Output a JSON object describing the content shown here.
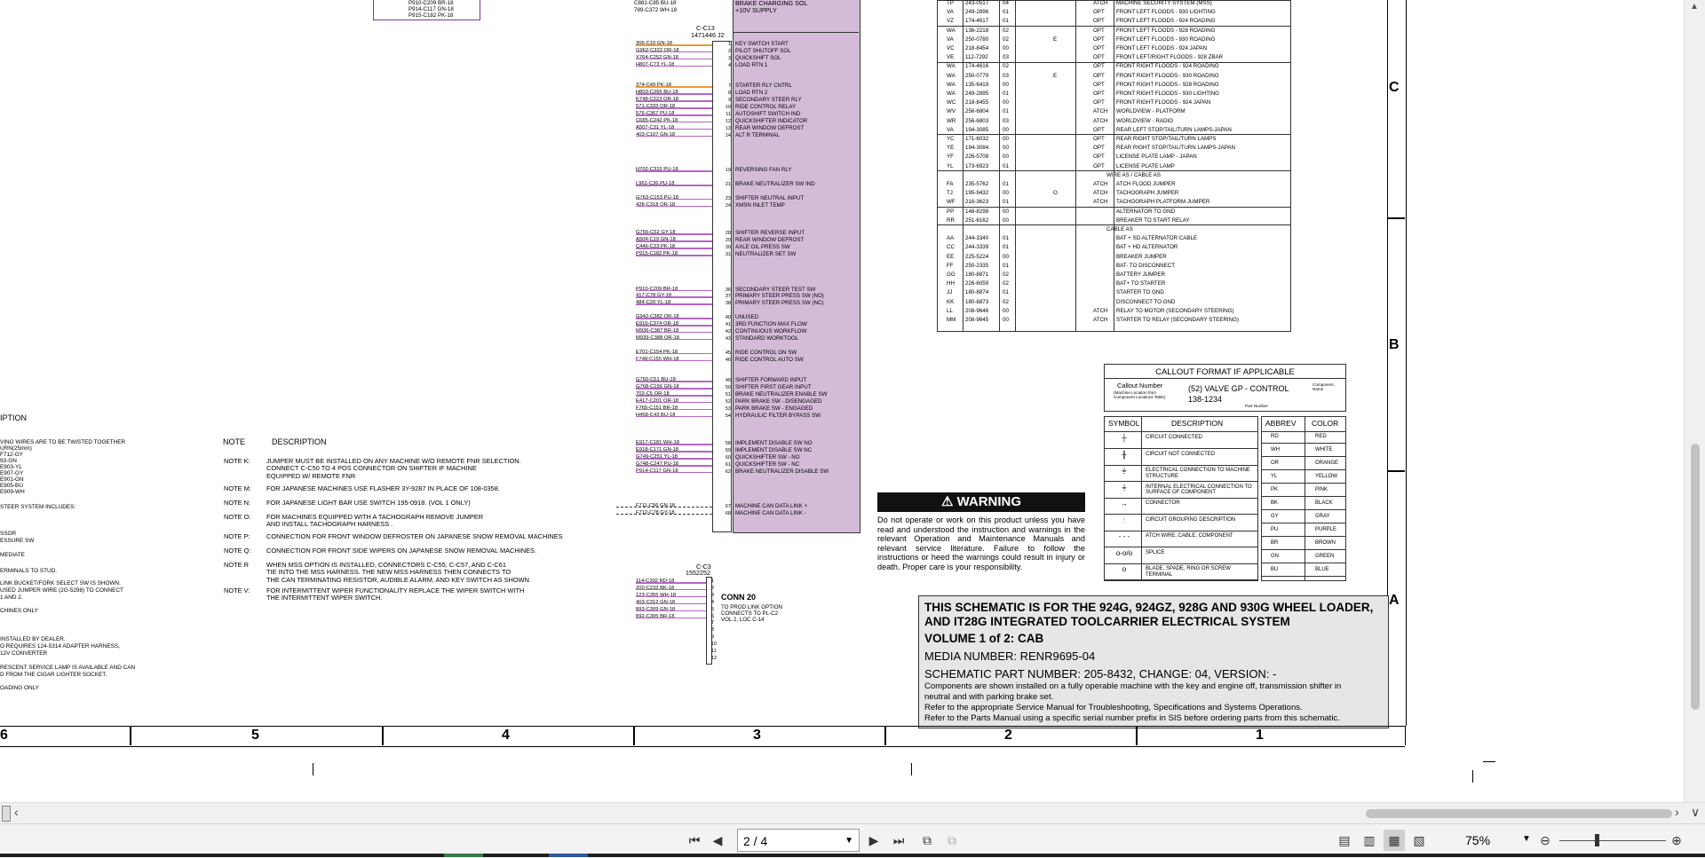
{
  "viewer": {
    "page_indicator": "2 / 4",
    "zoom": "75%"
  },
  "pins_text": {
    "top_left_wires": [
      "P910-C209 BR-18",
      "P914-C117 GN-18",
      "P915-C182 PK-18"
    ],
    "top_circuits": [
      "C881-C85 BU-18",
      "789-C372 WH-18"
    ],
    "top_descs": [
      "BRAKE CHARGING SOL",
      "+10V SUPPLY"
    ],
    "conn_c13_name": "C-C13",
    "conn_c13_part": "1471446 J2"
  },
  "connector_rows": [
    {
      "pin": "1",
      "circuit": "306-C10 GN-18",
      "desc": "KEY SWITCH START",
      "color": "or"
    },
    {
      "pin": "2",
      "circuit": "G962-C322 OR-18",
      "desc": "PILOT SHUTOFF SOL",
      "color": "pu"
    },
    {
      "pin": "3",
      "circuit": "X764-C252 GN-18",
      "desc": "QUICKSHIFT SOL",
      "color": "pu"
    },
    {
      "pin": "4",
      "circuit": "H807-C73 YL-18",
      "desc": "LOAD RTN 1",
      "color": "pu"
    },
    {
      "pin": "7",
      "circuit": "374-C49 PK-18",
      "desc": "STARTER RLY CNTRL",
      "color": "or"
    },
    {
      "pin": "8",
      "circuit": "H803-C265 BU-18",
      "desc": "LOAD RTN 2",
      "color": "pu"
    },
    {
      "pin": "9",
      "circuit": "K748-C223 OR-18",
      "desc": "SECONDARY STEER RLY",
      "color": "pu"
    },
    {
      "pin": "10",
      "circuit": "571-C333 OR-18",
      "desc": "RIDE CONTROL RELAY",
      "color": "pu"
    },
    {
      "pin": "11",
      "circuit": "576-C367 PU-18",
      "desc": "AUTOSHIFT SWITCH IND",
      "color": "pu"
    },
    {
      "pin": "12",
      "circuit": "C685-C242 PK-18",
      "desc": "QUICKSHIFTER INDICATOR",
      "color": "pu"
    },
    {
      "pin": "13",
      "circuit": "A507-C31 YL-18",
      "desc": "REAR WINDOW DEFROST",
      "color": "pu"
    },
    {
      "pin": "14",
      "circuit": "403-C107 GN-18",
      "desc": "ALT R TERMINAL",
      "color": "pu"
    },
    {
      "pin": "19",
      "circuit": "H702-C315 PU-18",
      "desc": "REVERSING FAN RLY",
      "color": "pu"
    },
    {
      "pin": "21",
      "circuit": "L961-C36 PU-18",
      "desc": "BRAKE NEUTRALIZER SW IND",
      "color": "pu"
    },
    {
      "pin": "23",
      "circuit": "G763-C153 PU-18",
      "desc": "SHIFTER NEUTRAL INPUT",
      "color": "pu"
    },
    {
      "pin": "24",
      "circuit": "428-C318 OR-18",
      "desc": "XMSN INLET TEMP",
      "color": "pu"
    },
    {
      "pin": "28",
      "circuit": "G755-C52 GY-18",
      "desc": "SHIFTER REVERSE INPUT",
      "color": "pu"
    },
    {
      "pin": "29",
      "circuit": "A504-C19 GN-18",
      "desc": "REAR WINDOW DEFROST",
      "color": "pu"
    },
    {
      "pin": "30",
      "circuit": "C446-C23 PK-18",
      "desc": "AXLE OIL PRESS SW",
      "color": "pu"
    },
    {
      "pin": "31",
      "circuit": "P915-C182 PK-18",
      "desc": "NEUTRALIZER SET SW",
      "color": "pu"
    },
    {
      "pin": "36",
      "circuit": "P910-C209 BR-18",
      "desc": "SECONDARY STEER TEST SW",
      "color": "pu"
    },
    {
      "pin": "37",
      "circuit": "417-C78 GY-18",
      "desc": "PRIMARY STEER PRESS SW (NO)",
      "color": "pu"
    },
    {
      "pin": "38",
      "circuit": "484-C20 YL-18",
      "desc": "PRIMARY STEER PRESS SW (NC)",
      "color": "pu"
    },
    {
      "pin": "40",
      "circuit": "G942-C382 OR-18",
      "desc": "UNUSED",
      "color": "pu"
    },
    {
      "pin": "41",
      "circuit": "E916-C374 OR-18",
      "desc": "3RD FUNCTION MAX FLOW",
      "color": "pu"
    },
    {
      "pin": "42",
      "circuit": "M936-C387 BR-18",
      "desc": "CONTINUOUS WORKFLOW",
      "color": "pu"
    },
    {
      "pin": "43",
      "circuit": "M939-C388 OR-18",
      "desc": "STANDARD WORKTOOL",
      "color": "pu"
    },
    {
      "pin": "45",
      "circuit": "E701-C154 PK-18",
      "desc": "RIDE CONTROL ON SW",
      "color": "pu"
    },
    {
      "pin": "46",
      "circuit": "F748-C155 WH-18",
      "desc": "RIDE CONTROL AUTO SW",
      "color": "pu"
    },
    {
      "pin": "49",
      "circuit": "G750-C51 BU-18",
      "desc": "SHIFTER FORWARD INPUT",
      "color": "pu"
    },
    {
      "pin": "50",
      "circuit": "G768-C156 GN-18",
      "desc": "SHIFTER FIRST GEAR INPUT",
      "color": "pu"
    },
    {
      "pin": "51",
      "circuit": "702-C5 OR-18",
      "desc": "BRAKE NEUTRALIZER ENABLE SW",
      "color": "pu"
    },
    {
      "pin": "52",
      "circuit": "E417-C201 OR-18",
      "desc": "PARK BRAKE SW - DISENGAGED",
      "color": "pu"
    },
    {
      "pin": "53",
      "circuit": "F765-C151 BR-18",
      "desc": "PARK BRAKE SW - ENGAGED",
      "color": "pu"
    },
    {
      "pin": "54",
      "circuit": "H458-C43 BU-18",
      "desc": "HYDRAULIC FILTER BYPASS SW",
      "color": "pu"
    },
    {
      "pin": "58",
      "circuit": "E917-C181 WH-18",
      "desc": "IMPLEMENT DISABLE SW NO",
      "color": "pu"
    },
    {
      "pin": "59",
      "circuit": "E918-C171 GN-18",
      "desc": "IMPLEMENT DISABLE SW NC",
      "color": "pu"
    },
    {
      "pin": "60",
      "circuit": "G749-C251 YL-18",
      "desc": "QUICKSHIFTER SW - NO",
      "color": "pu"
    },
    {
      "pin": "61",
      "circuit": "G748-C247 PU-18",
      "desc": "QUICKSHIFTER SW - NC",
      "color": "pu"
    },
    {
      "pin": "62",
      "circuit": "P914-C117 GN-18",
      "desc": "BRAKE NEUTRALIZER DISABLE SW",
      "color": "pu"
    },
    {
      "pin": "67",
      "circuit": "F711-C56 GN-18",
      "desc": "MACHINE CAN DATA LINK +",
      "color": "dash"
    },
    {
      "pin": "68",
      "circuit": "F712-C78 GY-18",
      "desc": "MACHINE CAN DATA LINK -",
      "color": "dash"
    }
  ],
  "conn_c3": {
    "name": "C-C3",
    "part": "1552252",
    "rows": [
      {
        "pin": "1",
        "circuit": "114-C302 RD-18"
      },
      {
        "pin": "2",
        "circuit": "200-C232 BK-18"
      },
      {
        "pin": "3",
        "circuit": "123-C355 WH-18"
      },
      {
        "pin": "4",
        "circuit": "403-C312 GN-18"
      },
      {
        "pin": "5",
        "circuit": "893-C309 GN-18"
      },
      {
        "pin": "6",
        "circuit": "892-C305 BR-18"
      }
    ],
    "conn_title": "CONN 20",
    "conn_note": [
      "TO PROD LINK OPTION",
      "CONNECTS TO PL-C2",
      "VOL 2, LOC C-14"
    ],
    "pins_extra": [
      "7",
      "8",
      "9",
      "10",
      "11",
      "12"
    ]
  },
  "right_table": [
    {
      "code": "TP",
      "part": "243-0517",
      "rev": "04",
      "mark": "",
      "type": "ATCH",
      "desc": "MACHINE SECURITY SYSTEM (MSS)"
    },
    {
      "code": "VA",
      "part": "249-2896",
      "rev": "01",
      "mark": "",
      "type": "OPT",
      "desc": "FRONT LEFT FLOODS - 930 LIGHTING"
    },
    {
      "code": "VZ",
      "part": "174-4617",
      "rev": "01",
      "mark": "",
      "type": "OPT",
      "desc": "FRONT LEFT FLOODS - 924 ROADING"
    },
    {
      "code": "WA",
      "part": "136-2218",
      "rev": "02",
      "mark": "",
      "type": "OPT",
      "desc": "FRONT LEFT FLOODS - 928 ROADING"
    },
    {
      "code": "VA",
      "part": "250-0780",
      "rev": "02",
      "mark": "E",
      "type": "OPT",
      "desc": "FRONT LEFT FLOODS - 930 ROADING"
    },
    {
      "code": "VC",
      "part": "218-8454",
      "rev": "00",
      "mark": "",
      "type": "OPT",
      "desc": "FRONT LEFT FLOODS - 924 JAPAN"
    },
    {
      "code": "VE",
      "part": "112-7292",
      "rev": "03",
      "mark": "",
      "type": "OPT",
      "desc": "FRONT LEFT/RIGHT FLOODS - 928 ZBAR"
    },
    {
      "code": "WA",
      "part": "174-4616",
      "rev": "02",
      "mark": "",
      "type": "OPT",
      "desc": "FRONT RIGHT FLOODS - 924 ROADING"
    },
    {
      "code": "WA",
      "part": "250-0779",
      "rev": "03",
      "mark": "E",
      "type": "OPT",
      "desc": "FRONT RIGHT FLOODS - 930 ROADING"
    },
    {
      "code": "WA",
      "part": "135-6419",
      "rev": "00",
      "mark": "",
      "type": "OPT",
      "desc": "FRONT RIGHT FLOODS - 928 ROADING"
    },
    {
      "code": "WA",
      "part": "249-2895",
      "rev": "01",
      "mark": "",
      "type": "OPT",
      "desc": "FRONT RIGHT FLOODS - 930 LIGHTING"
    },
    {
      "code": "WC",
      "part": "218-8455",
      "rev": "00",
      "mark": "",
      "type": "OPT",
      "desc": "FRONT RIGHT FLOODS - 924 JAPAN"
    },
    {
      "code": "WV",
      "part": "256-6804",
      "rev": "01",
      "mark": "",
      "type": "ATCH",
      "desc": "WORLDVIEW - PLATFORM"
    },
    {
      "code": "WR",
      "part": "256-6803",
      "rev": "03",
      "mark": "",
      "type": "ATCH",
      "desc": "WORLDVIEW - RADIO"
    },
    {
      "code": "VA",
      "part": "194-3085",
      "rev": "00",
      "mark": "",
      "type": "OPT",
      "desc": "REAR LEFT STOP/TAIL/TURN LAMPS-JAPAN"
    },
    {
      "code": "YC",
      "part": "171-6032",
      "rev": "00",
      "mark": "",
      "type": "OPT",
      "desc": "REAR RIGHT STOP/TAIL/TURN LAMPS"
    },
    {
      "code": "YE",
      "part": "194-3084",
      "rev": "00",
      "mark": "",
      "type": "OPT",
      "desc": "REAR RIGHT STOP/TAIL/TURN LAMPS-JAPAN"
    },
    {
      "code": "YF",
      "part": "226-5708",
      "rev": "00",
      "mark": "",
      "type": "OPT",
      "desc": "LICENSE PLATE LAMP - JAPAN"
    },
    {
      "code": "YL",
      "part": "173-6923",
      "rev": "01",
      "mark": "",
      "type": "OPT",
      "desc": "LICENSE PLATE LAMP"
    },
    {
      "code": "",
      "part": "",
      "rev": "",
      "mark": "",
      "type": "",
      "desc": "WIRE AS / CABLE AS"
    },
    {
      "code": "FA",
      "part": "235-5762",
      "rev": "01",
      "mark": "",
      "type": "ATCH",
      "desc": "ATCH FLOOD JUMPER"
    },
    {
      "code": "TJ",
      "part": "195-9432",
      "rev": "00",
      "mark": "O",
      "type": "ATCH",
      "desc": "TACHOGRAPH JUMPER"
    },
    {
      "code": "WF",
      "part": "218-3623",
      "rev": "01",
      "mark": "",
      "type": "ATCH",
      "desc": "TACHOGRAPH PLATFORM JUMPER"
    },
    {
      "code": "PP",
      "part": "148-8298",
      "rev": "00",
      "mark": "",
      "type": "",
      "desc": "ALTERNATOR TO GND"
    },
    {
      "code": "RR",
      "part": "251-6162",
      "rev": "00",
      "mark": "",
      "type": "",
      "desc": "BREAKER TO START RELAY"
    },
    {
      "code": "",
      "part": "",
      "rev": "",
      "mark": "",
      "type": "",
      "desc": "CABLE AS"
    },
    {
      "code": "AA",
      "part": "244-3340",
      "rev": "01",
      "mark": "",
      "type": "",
      "desc": "BAT + SD ALTERNATOR CABLE"
    },
    {
      "code": "CC",
      "part": "244-3339",
      "rev": "01",
      "mark": "",
      "type": "",
      "desc": "BAT + HD ALTERNATOR"
    },
    {
      "code": "EE",
      "part": "225-5224",
      "rev": "00",
      "mark": "",
      "type": "",
      "desc": "BREAKER JUMPER"
    },
    {
      "code": "FF",
      "part": "250-2335",
      "rev": "01",
      "mark": "",
      "type": "",
      "desc": "BAT- TO DISCONNECT"
    },
    {
      "code": "GG",
      "part": "180-8871",
      "rev": "02",
      "mark": "",
      "type": "",
      "desc": "BATTERY JUMPER"
    },
    {
      "code": "HH",
      "part": "226-6059",
      "rev": "02",
      "mark": "",
      "type": "",
      "desc": "BAT+ TO STARTER"
    },
    {
      "code": "JJ",
      "part": "180-8874",
      "rev": "01",
      "mark": "",
      "type": "",
      "desc": "STARTER TO GND"
    },
    {
      "code": "KK",
      "part": "180-8873",
      "rev": "02",
      "mark": "",
      "type": "",
      "desc": "DISCONNECT TO GND"
    },
    {
      "code": "LL",
      "part": "208-9646",
      "rev": "00",
      "mark": "",
      "type": "ATCH",
      "desc": "RELAY TO MOTOR (SECONDARY STEERING)"
    },
    {
      "code": "MM",
      "part": "208-9645",
      "rev": "00",
      "mark": "",
      "type": "ATCH",
      "desc": "STARTER TO RELAY (SECONDARY STEERING)"
    }
  ],
  "callout": {
    "title": "CALLOUT FORMAT IF APPLICABLE",
    "number_label": "Callout Number",
    "number_sub": "(Machine Location from Component Locations Table)",
    "example": "(52) VALVE GP - CONTROL",
    "part": "138-1234",
    "comp_label": "Component Name",
    "part_label": "Part Number"
  },
  "symbols": {
    "header_symbol": "SYMBOL",
    "header_desc": "DESCRIPTION",
    "rows": [
      {
        "icon": "circuit-connected-icon",
        "glyph": "┼",
        "desc": "CIRCUIT CONNECTED"
      },
      {
        "icon": "circuit-not-connected-icon",
        "glyph": "╫",
        "desc": "CIRCUIT NOT CONNECTED"
      },
      {
        "icon": "electrical-connection-icon",
        "glyph": "⏚",
        "desc": "ELECTRICAL CONNECTION TO MACHINE STRUCTURE"
      },
      {
        "icon": "internal-connection-icon",
        "glyph": "⏚",
        "desc": "INTERNAL ELECTRICAL CONNECTION TO SURFACE OF COMPONENT"
      },
      {
        "icon": "connector-icon",
        "glyph": "→",
        "desc": "CONNECTOR"
      },
      {
        "icon": "circuit-grouping-icon",
        "glyph": "⫶",
        "desc": "CIRCUIT GROUPING DESCRIPTION"
      },
      {
        "icon": "atch-wire-icon",
        "glyph": "- - -",
        "desc": "ATCH WIRE, CABLE, COMPONENT"
      },
      {
        "icon": "splice-icon",
        "glyph": "o-o/o",
        "desc": "SPLICE"
      },
      {
        "icon": "terminal-icon",
        "glyph": "o",
        "desc": "BLADE, SPADE, RING OR SCREW TERMINAL"
      }
    ]
  },
  "colors_legend": {
    "header_abbrev": "ABBREV",
    "header_color": "COLOR",
    "rows": [
      {
        "abbrev": "RD",
        "color": "RED"
      },
      {
        "abbrev": "WH",
        "color": "WHITE"
      },
      {
        "abbrev": "OR",
        "color": "ORANGE"
      },
      {
        "abbrev": "YL",
        "color": "YELLOW"
      },
      {
        "abbrev": "PK",
        "color": "PINK"
      },
      {
        "abbrev": "BK",
        "color": "BLACK"
      },
      {
        "abbrev": "GY",
        "color": "GRAY"
      },
      {
        "abbrev": "PU",
        "color": "PURPLE"
      },
      {
        "abbrev": "BR",
        "color": "BROWN"
      },
      {
        "abbrev": "GN",
        "color": "GREEN"
      },
      {
        "abbrev": "BU",
        "color": "BLUE"
      }
    ]
  },
  "warning": {
    "title": "WARNING",
    "text": "Do not operate or work on this product unless you have read and understood the instruction and warnings in the relevant Operation and Maintenance Manuals and relevant service literature. Failure to follow the instructions or heed the warnings could result in injury or death. Proper care is your responsibility."
  },
  "title_block": {
    "line1": "THIS SCHEMATIC IS FOR THE 924G, 924GZ, 928G AND 930G WHEEL LOADER,",
    "line2": "AND IT28G INTEGRATED TOOLCARRIER ELECTRICAL SYSTEM",
    "line3": "VOLUME 1 of 2: CAB",
    "line4": "MEDIA NUMBER: RENR9695-04",
    "line5": "SCHEMATIC PART NUMBER: 205-8432, CHANGE: 04, VERSION: -",
    "line6": "Components are shown installed on a fully operable machine with the key and engine off, transmission shifter in neutral and with parking brake set.",
    "line7": "Refer to the appropriate Service Manual for Troubleshooting, Specifications and Systems Operations.",
    "line8": "Refer to the Parts Manual using a specific serial number prefix in SIS before ordering parts from this schematic."
  },
  "notes": {
    "header_note": "NOTE",
    "header_desc": "DESCRIPTION",
    "items": [
      {
        "id": "NOTE K:",
        "text": [
          "JUMPER MUST BE INSTALLED ON ANY MACHINE W/O REMOTE FNR SELECTION.",
          "CONNECT C-C50 TO 4 POS CONNECTOR ON SHIFTER IF MACHINE",
          "EQUIPPED W/ REMOTE FNR"
        ]
      },
      {
        "id": "NOTE M:",
        "text": [
          "FOR JAPANESE MACHINES USE FLASHER 3Y-9287 IN PLACE OF 108-0358."
        ]
      },
      {
        "id": "NOTE N:",
        "text": [
          "FOR JAPANESE LIGHT BAR USE SWITCH 195-0918. (VOL 1 ONLY)"
        ]
      },
      {
        "id": "NOTE O:",
        "text": [
          "FOR MACHINES EQUIPPED WITH A TACHOGRAPH REMOVE JUMPER",
          "AND INSTALL TACHOGRAPH HARNESS ."
        ]
      },
      {
        "id": "NOTE P:",
        "text": [
          "CONNECTION FOR FRONT WINDOW DEFROSTER ON JAPANESE SNOW REMOVAL MACHINES"
        ]
      },
      {
        "id": "NOTE Q:",
        "text": [
          "CONNECTION FOR FRONT SIDE WIPERS ON JAPANESE SNOW REMOVAL MACHINES."
        ]
      },
      {
        "id": "NOTE R",
        "text": [
          "WHEN MSS OPTION IS INSTALLED, CONNECTORS C-C55, C-C57, AND C-C61",
          "TIE INTO THE MSS HARNESS. THE NEW MSS HARNESS THEN CONNECTS TO",
          "THE CAN TERMINATING RESISTOR, AUDIBLE ALARM, AND KEY SWITCH AS SHOWN"
        ]
      },
      {
        "id": "NOTE V:",
        "text": [
          "FOR INTERMITTENT WIPER FUNCTIONALITY REPLACE THE WIPER SWITCH WITH",
          "THE INTERMITTENT WIPER SWITCH."
        ]
      }
    ],
    "left_fragments": [
      "IPTION",
      "VING WIRES ARE TO BE TWISTED TOGETHER",
      "URN(25mm)",
      "F712-GY",
      "93-GN",
      "E903-YL",
      "E907-GY",
      "E901-GN",
      "E905-BU",
      "E909-WH",
      "STEER SYSTEM INCLUDES:",
      "SSOR",
      "ESSURE SW",
      "MEDIATE",
      "ERMINALS TO STUD.",
      "LINK BUCKET/FORK SELECT SW IS SHOWN.",
      "USED JUMPER WIRE (2G-5298) TO CONNECT",
      "1 AND 2.",
      "CHINES ONLY",
      "INSTALLED BY DEALER.",
      "O REQUIRES 124-5314 ADAPTER HARNESS,",
      "12V CONVERTER",
      "RESCENT SERVICE LAMP IS AVAILABLE AND CAN",
      "D FROM THE CIGAR LIGHTER SOCKET.",
      "OADING ONLY"
    ]
  },
  "zones": {
    "cols": [
      "6",
      "5",
      "4",
      "3",
      "2",
      "1"
    ],
    "rows": [
      "C",
      "B",
      "A"
    ]
  }
}
